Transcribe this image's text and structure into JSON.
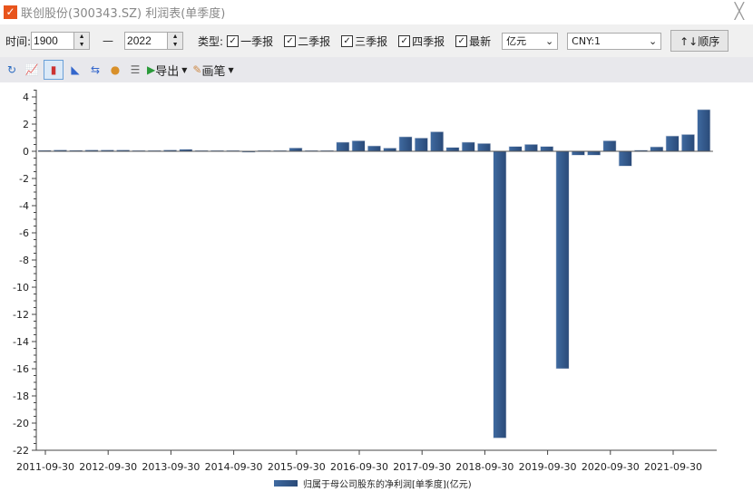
{
  "window": {
    "title": "联创股份(300343.SZ) 利润表(单季度)",
    "close": "╳"
  },
  "toolbar": {
    "time_label": "时间:",
    "start_year": "1900",
    "dash": "—",
    "end_year": "2022",
    "type_label": "类型:",
    "checks": [
      {
        "label": "一季报",
        "checked": true
      },
      {
        "label": "二季报",
        "checked": true
      },
      {
        "label": "三季报",
        "checked": true
      },
      {
        "label": "四季报",
        "checked": true
      },
      {
        "label": "最新",
        "checked": true
      }
    ],
    "unit": "亿元",
    "currency": "CNY:1",
    "order_button": "↑↓顺序"
  },
  "toolbar2": {
    "export": "导出",
    "pen": "画笔"
  },
  "colors": {
    "bar": "#2a4a78",
    "bar_light": "#3f6aa0"
  },
  "chart_data": {
    "type": "bar",
    "title": "",
    "xlabel": "",
    "ylabel": "",
    "ylim": [
      -22,
      4
    ],
    "yticks": [
      4,
      2,
      0,
      -2,
      -4,
      -6,
      -8,
      -10,
      -12,
      -14,
      -16,
      -18,
      -20,
      -22
    ],
    "xtick_labels": [
      "2011-09-30",
      "2012-09-30",
      "2013-09-30",
      "2014-09-30",
      "2015-09-30",
      "2016-09-30",
      "2017-09-30",
      "2018-09-30",
      "2019-09-30",
      "2020-09-30",
      "2021-09-30"
    ],
    "legend": "归属于母公司股东的净利润[单季度](亿元)",
    "legend_position": "bottom",
    "categories": [
      "2011-09-30",
      "2011-12-31",
      "2012-03-31",
      "2012-06-30",
      "2012-09-30",
      "2012-12-31",
      "2013-03-31",
      "2013-06-30",
      "2013-09-30",
      "2013-12-31",
      "2014-03-31",
      "2014-06-30",
      "2014-09-30",
      "2014-12-31",
      "2015-03-31",
      "2015-06-30",
      "2015-09-30",
      "2015-12-31",
      "2016-03-31",
      "2016-06-30",
      "2016-09-30",
      "2016-12-31",
      "2017-03-31",
      "2017-06-30",
      "2017-09-30",
      "2017-12-31",
      "2018-03-31",
      "2018-06-30",
      "2018-09-30",
      "2018-12-31",
      "2019-03-31",
      "2019-06-30",
      "2019-09-30",
      "2019-12-31",
      "2020-03-31",
      "2020-06-30",
      "2020-09-30",
      "2020-12-31",
      "2021-03-31",
      "2021-06-30",
      "2021-09-30",
      "2021-12-31",
      "2022-03-31"
    ],
    "values": [
      0.08,
      0.1,
      0.08,
      0.1,
      0.1,
      0.1,
      0.07,
      0.07,
      0.1,
      0.15,
      0.07,
      0.07,
      0.07,
      -0.08,
      0.07,
      0.07,
      0.25,
      0.07,
      0.07,
      0.67,
      0.78,
      0.4,
      0.24,
      1.07,
      0.98,
      1.44,
      0.29,
      0.67,
      0.58,
      -21.1,
      0.36,
      0.51,
      0.36,
      -16.0,
      -0.29,
      -0.29,
      0.78,
      -1.09,
      0.09,
      0.33,
      1.13,
      1.24,
      3.07
    ]
  }
}
